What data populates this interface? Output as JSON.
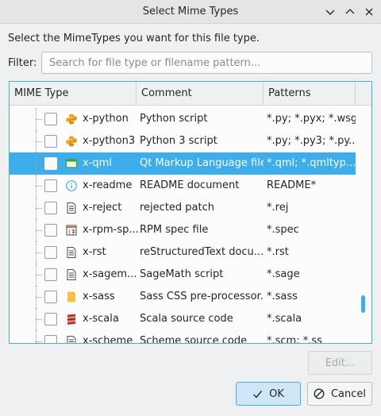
{
  "window": {
    "title": "Select Mime Types"
  },
  "prompt": "Select the MimeTypes you want for this file type.",
  "filter": {
    "label": "Filter:",
    "placeholder": "Search for file type or filename pattern...",
    "value": ""
  },
  "table": {
    "columns": [
      "MIME Type",
      "Comment",
      "Patterns"
    ],
    "rows": [
      {
        "name": "x-python",
        "comment": "Python script",
        "patterns": "*.py; *.pyx; *.wsgi",
        "icon": "python-icon",
        "selected": false
      },
      {
        "name": "x-python3",
        "comment": "Python 3 script",
        "patterns": "*.py; *.py3; *.py...",
        "icon": "python-icon",
        "selected": false
      },
      {
        "name": "x-qml",
        "comment": "Qt Markup Language file",
        "patterns": "*.qml; *.qmltyp...",
        "icon": "qml-icon",
        "selected": true
      },
      {
        "name": "x-readme",
        "comment": "README document",
        "patterns": "README*",
        "icon": "info-icon",
        "selected": false
      },
      {
        "name": "x-reject",
        "comment": "rejected patch",
        "patterns": "*.rej",
        "icon": "text-file-icon",
        "selected": false
      },
      {
        "name": "x-rpm-sp...",
        "comment": "RPM spec file",
        "patterns": "*.spec",
        "icon": "rpm-spec-icon",
        "selected": false
      },
      {
        "name": "x-rst",
        "comment": "reStructuredText docu...",
        "patterns": "*.rst",
        "icon": "text-file-icon",
        "selected": false
      },
      {
        "name": "x-sagem...",
        "comment": "SageMath script",
        "patterns": "*.sage",
        "icon": "text-file-icon",
        "selected": false
      },
      {
        "name": "x-sass",
        "comment": "Sass CSS pre-processor...",
        "patterns": "*.sass",
        "icon": "sass-icon",
        "selected": false
      },
      {
        "name": "x-scala",
        "comment": "Scala source code",
        "patterns": "*.scala",
        "icon": "scala-icon",
        "selected": false
      },
      {
        "name": "x-scheme",
        "comment": "Scheme source code",
        "patterns": "*.scm; *.ss",
        "icon": "text-file-icon",
        "selected": false
      }
    ]
  },
  "buttons": {
    "edit": "Edit...",
    "ok": "OK",
    "cancel": "Cancel"
  },
  "colors": {
    "accent": "#3daee9",
    "python": "#f5a21a",
    "qml": "#41a13b",
    "scala": "#c0392b",
    "sass": "#f6c344"
  }
}
